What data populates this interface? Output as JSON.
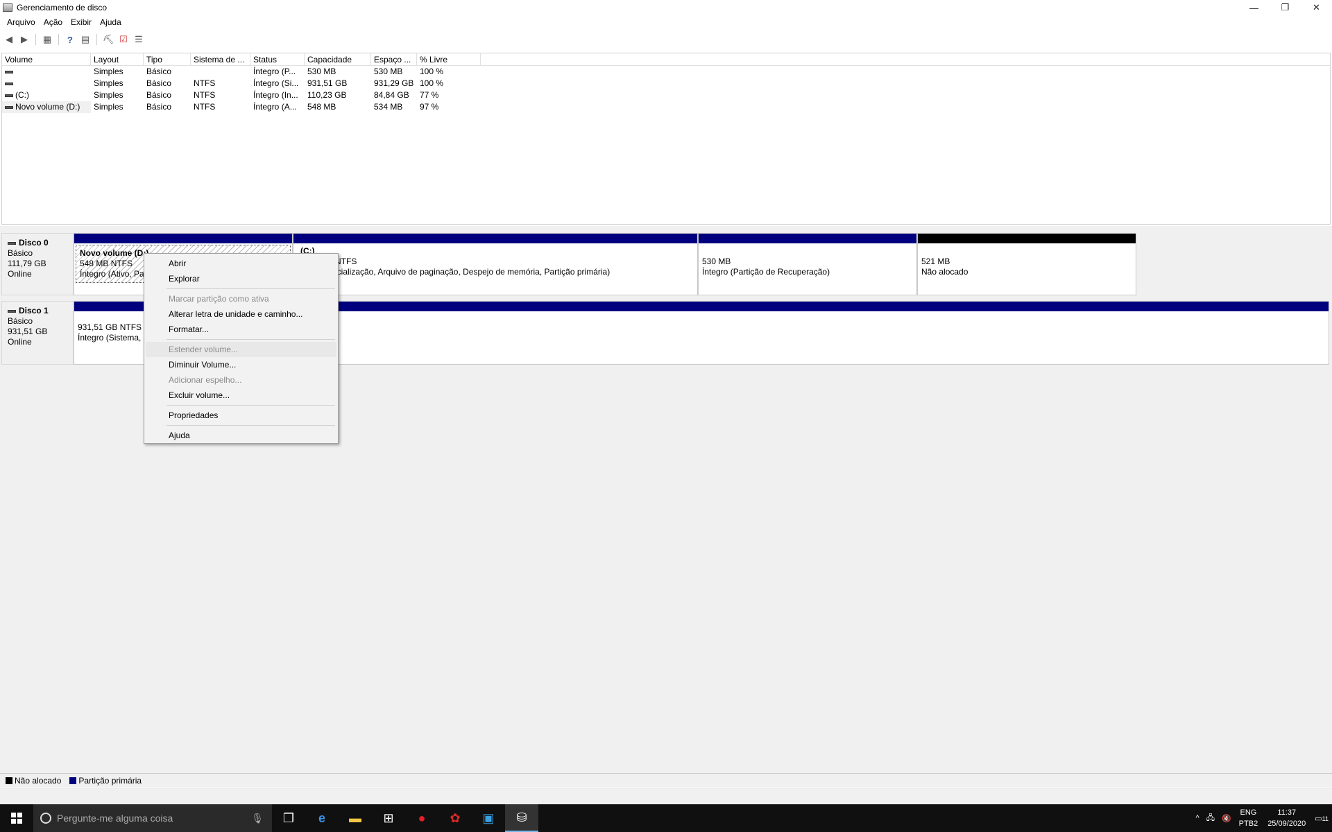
{
  "window": {
    "title": "Gerenciamento de disco",
    "minimize": "—",
    "restore": "❐",
    "close": "✕"
  },
  "menu": [
    "Arquivo",
    "Ação",
    "Exibir",
    "Ajuda"
  ],
  "toolbar": {
    "icons": [
      "back-icon",
      "forward-icon",
      "console-tree-icon",
      "help-icon",
      "properties-icon",
      "rescan-icon",
      "checklist-icon",
      "list-view-icon"
    ]
  },
  "volume_list": {
    "headers": [
      "Volume",
      "Layout",
      "Tipo",
      "Sistema de ...",
      "Status",
      "Capacidade",
      "Espaço ...",
      "% Livre"
    ],
    "rows": [
      [
        "",
        "Simples",
        "Básico",
        "",
        "Íntegro (P...",
        "530 MB",
        "530 MB",
        "100 %"
      ],
      [
        "",
        "Simples",
        "Básico",
        "NTFS",
        "Íntegro (Si...",
        "931,51 GB",
        "931,29 GB",
        "100 %"
      ],
      [
        "(C:)",
        "Simples",
        "Básico",
        "NTFS",
        "Íntegro (In...",
        "110,23 GB",
        "84,84 GB",
        "77 %"
      ],
      [
        "Novo volume (D:)",
        "Simples",
        "Básico",
        "NTFS",
        "Íntegro (A...",
        "548 MB",
        "534 MB",
        "97 %"
      ]
    ]
  },
  "disks": [
    {
      "name": "Disco 0",
      "type": "Básico",
      "size": "111,79 GB",
      "state": "Online",
      "partitions": [
        {
          "name": "Novo volume  (D:)",
          "size": "548 MB NTFS",
          "status": "Íntegro (Ativo, Pa"
        },
        {
          "name": "(C:)",
          "size": "NTFS",
          "status": "icialização, Arquivo de paginação, Despejo de memória, Partição primária)"
        },
        {
          "name": "",
          "size": "530 MB",
          "status": "Íntegro (Partição de Recuperação)"
        },
        {
          "name": "",
          "size": "521 MB",
          "status": "Não alocado"
        }
      ]
    },
    {
      "name": "Disco 1",
      "type": "Básico",
      "size": "931,51 GB",
      "state": "Online",
      "partitions": [
        {
          "name": "",
          "size": "931,51 GB NTFS",
          "status": "Íntegro (Sistema,"
        }
      ]
    }
  ],
  "legend": [
    {
      "label": "Não alocado",
      "color": "#000000"
    },
    {
      "label": "Partição primária",
      "color": "#00007f"
    }
  ],
  "context_menu": {
    "items": [
      {
        "label": "Abrir",
        "enabled": true
      },
      {
        "label": "Explorar",
        "enabled": true
      },
      {
        "label": "Marcar partição como ativa",
        "enabled": false
      },
      {
        "label": "Alterar letra de unidade e caminho...",
        "enabled": true
      },
      {
        "label": "Formatar...",
        "enabled": true
      },
      {
        "label": "Estender volume...",
        "enabled": false
      },
      {
        "label": "Diminuir Volume...",
        "enabled": true
      },
      {
        "label": "Adicionar espelho...",
        "enabled": false
      },
      {
        "label": "Excluir volume...",
        "enabled": true
      },
      {
        "label": "Propriedades",
        "enabled": true
      },
      {
        "label": "Ajuda",
        "enabled": true
      }
    ]
  },
  "taskbar": {
    "search_placeholder": "Pergunte-me alguma coisa",
    "apps": [
      "task-view-icon",
      "edge-icon",
      "file-explorer-icon",
      "store-icon",
      "opera-icon",
      "app-red-icon",
      "app-blue-icon",
      "disk-management-icon"
    ],
    "lang_top": "ENG",
    "lang_bottom": "PTB2",
    "time": "11:37",
    "date": "25/09/2020",
    "notifications": "11"
  }
}
